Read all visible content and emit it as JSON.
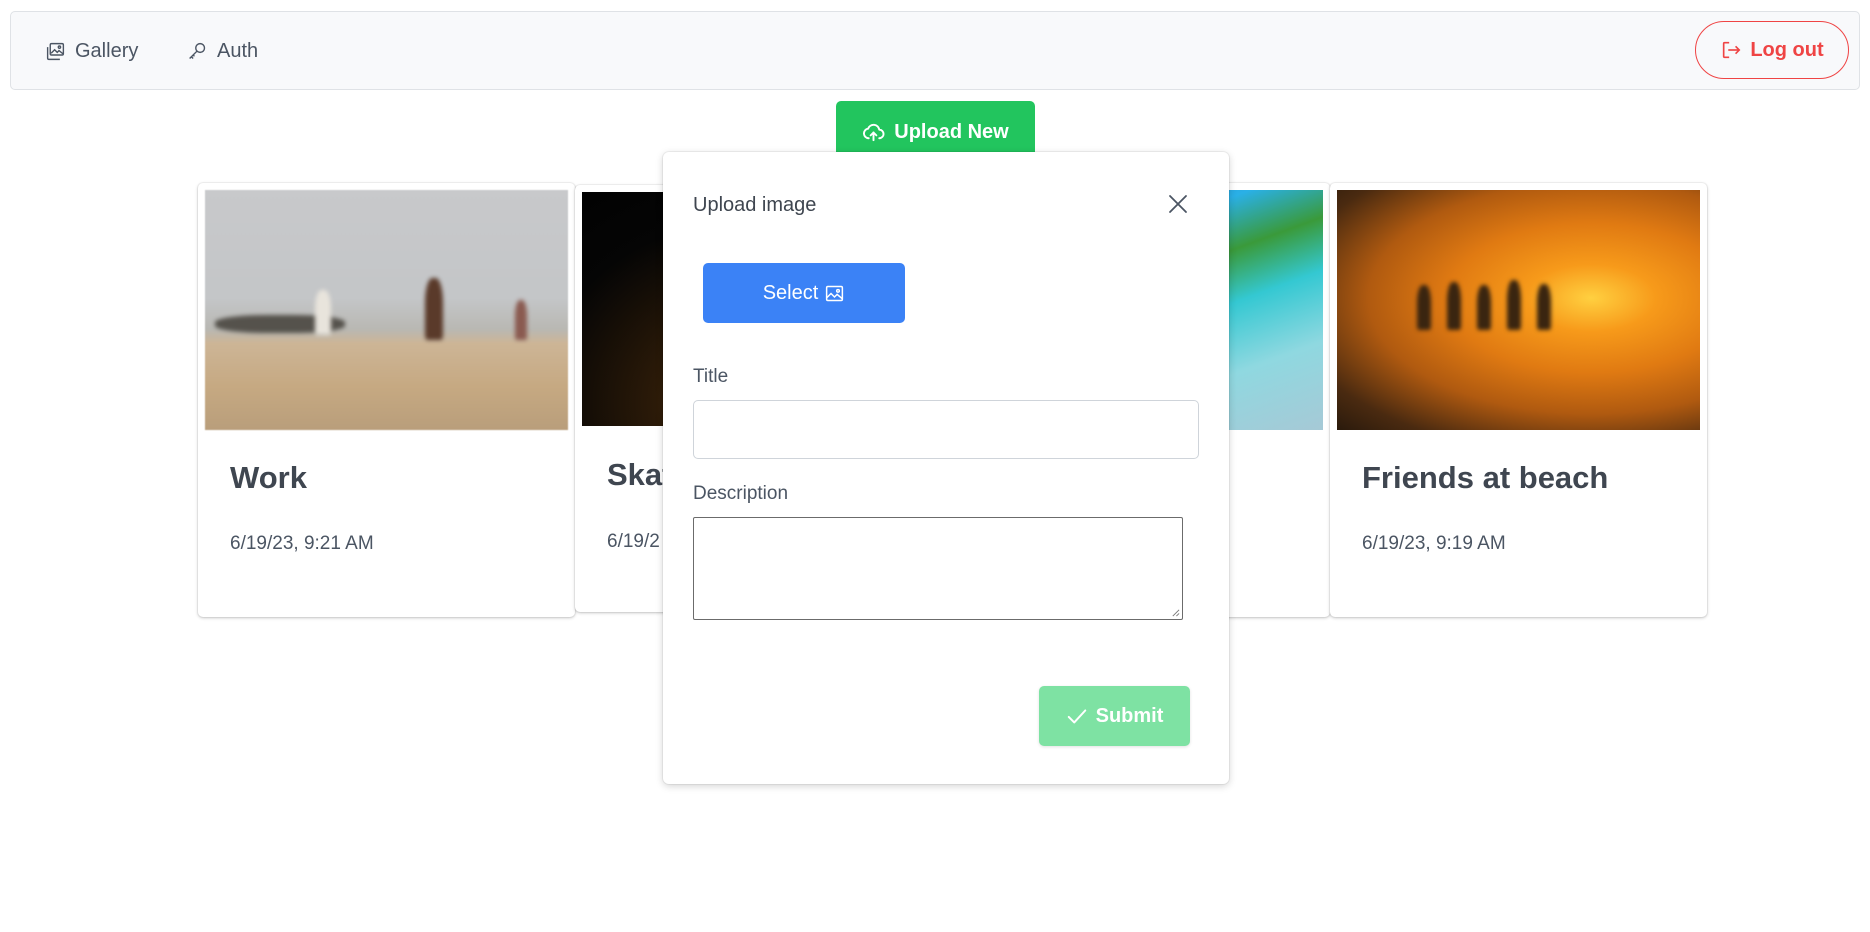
{
  "navbar": {
    "items": [
      {
        "label": "Gallery",
        "icon": "images-icon"
      },
      {
        "label": "Auth",
        "icon": "key-icon"
      }
    ],
    "logout_label": "Log out"
  },
  "upload_new_label": "Upload New",
  "cards": [
    {
      "title": "Work",
      "date": "6/19/23, 9:21 AM"
    },
    {
      "title": "Skat",
      "date": "6/19/2"
    },
    {
      "title": "",
      "date": ""
    },
    {
      "title": "Friends at beach",
      "date": "6/19/23, 9:19 AM"
    }
  ],
  "modal": {
    "title": "Upload image",
    "select_label": "Select",
    "title_field_label": "Title",
    "title_value": "",
    "description_label": "Description",
    "description_value": "",
    "submit_label": "Submit"
  },
  "colors": {
    "upload_green": "#22c55e",
    "logout_red": "#ef4444",
    "select_blue": "#3b82f6",
    "submit_disabled_green": "#7ee2a3"
  }
}
